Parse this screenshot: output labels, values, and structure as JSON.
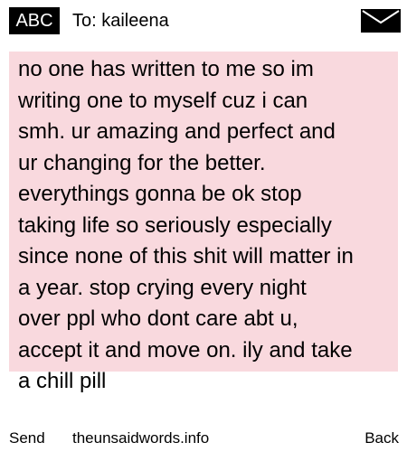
{
  "header": {
    "input_mode_label": "ABC",
    "to_label": "To: kaileena",
    "envelope_icon": "envelope-icon"
  },
  "message": {
    "text": "no one has written to me so im\nwriting one to myself cuz i can\nsmh. ur amazing and perfect and\nur changing for the better.\neverythings gonna be ok stop\ntaking life so seriously especially\nsince none of this shit will matter in\na year. stop crying every night\nover ppl who dont care abt u,\naccept it and move on. ily and take\na chill pill"
  },
  "softkeys": {
    "left_label": "Send",
    "center_label": "theunsaidwords.info",
    "right_label": "Back"
  },
  "colors": {
    "message_background": "#f9d9de",
    "badge_background": "#000000",
    "badge_text": "#ffffff"
  }
}
